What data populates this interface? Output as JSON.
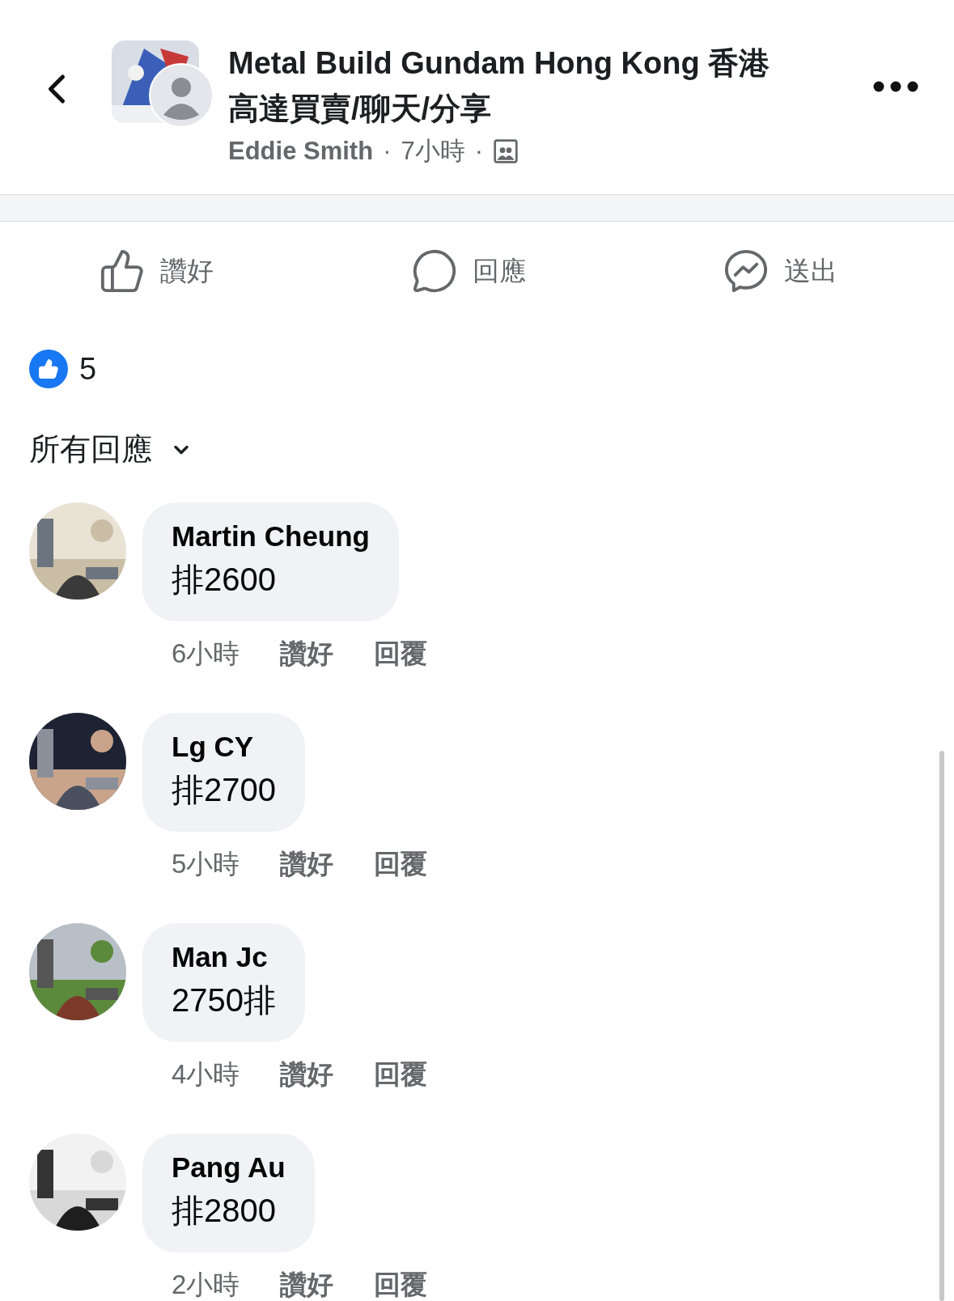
{
  "header": {
    "title": "Metal Build Gundam Hong Kong 香港高達買賣/聊天/分享",
    "author": "Eddie Smith",
    "separator": "·",
    "time": "7小時",
    "separator_2": "·"
  },
  "actions": [
    {
      "label": "讚好",
      "kind": "like"
    },
    {
      "label": "回應",
      "kind": "comment"
    },
    {
      "label": "送出",
      "kind": "send"
    }
  ],
  "reactions": {
    "count": "5"
  },
  "comments_filter": {
    "label": "所有回應"
  },
  "comments": [
    {
      "name": "Martin Cheung",
      "text": "排2600",
      "time": "6小時",
      "like": "讚好",
      "reply": "回覆"
    },
    {
      "name": "Lg CY",
      "text": "排2700",
      "time": "5小時",
      "like": "讚好",
      "reply": "回覆"
    },
    {
      "name": "Man Jc",
      "text": "2750排",
      "time": "4小時",
      "like": "讚好",
      "reply": "回覆"
    },
    {
      "name": "Pang Au",
      "text": "排2800",
      "time": "2小時",
      "like": "讚好",
      "reply": "回覆"
    }
  ]
}
